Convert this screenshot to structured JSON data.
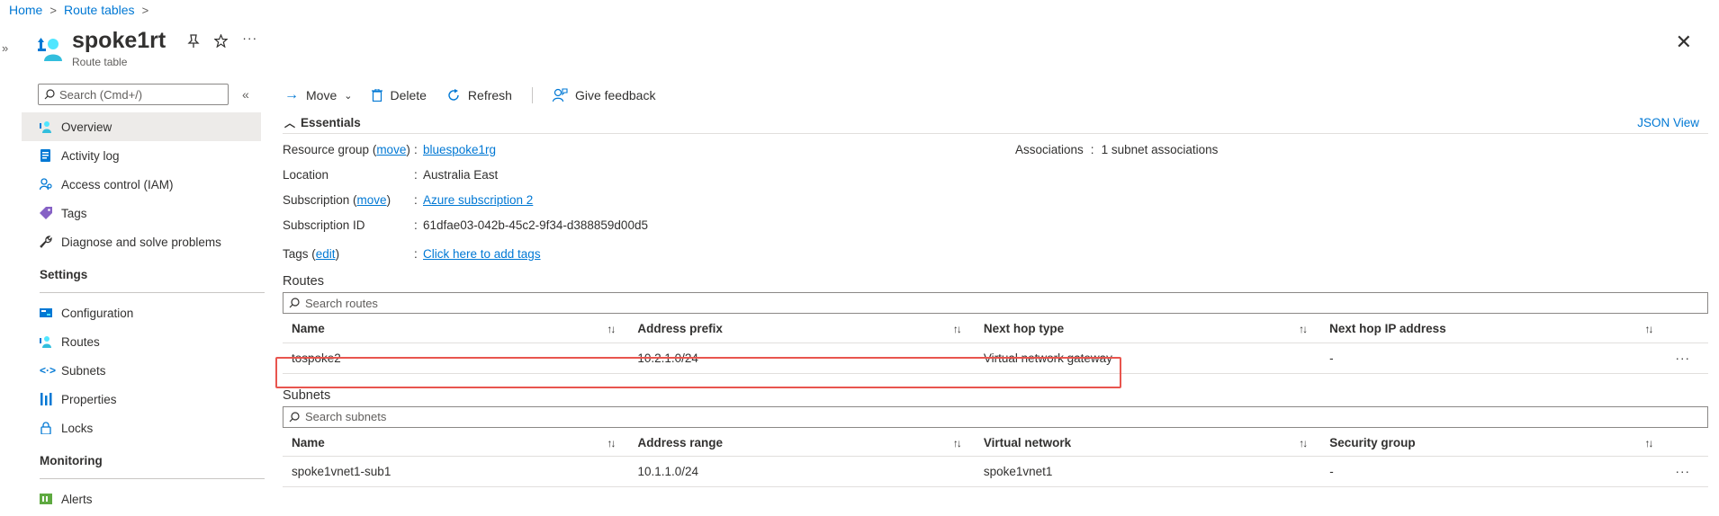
{
  "breadcrumb": [
    "Home",
    "Route tables"
  ],
  "resource": {
    "name": "spoke1rt",
    "type": "Route table"
  },
  "sidebar": {
    "search_placeholder": "Search (Cmd+/)",
    "items": [
      {
        "label": "Overview",
        "icon": "overview-icon",
        "active": true
      },
      {
        "label": "Activity log",
        "icon": "activity-log-icon"
      },
      {
        "label": "Access control (IAM)",
        "icon": "iam-icon"
      },
      {
        "label": "Tags",
        "icon": "tag-icon"
      },
      {
        "label": "Diagnose and solve problems",
        "icon": "wrench-icon"
      }
    ],
    "settings_header": "Settings",
    "settings_items": [
      {
        "label": "Configuration",
        "icon": "configuration-icon"
      },
      {
        "label": "Routes",
        "icon": "routes-icon"
      },
      {
        "label": "Subnets",
        "icon": "subnets-icon"
      },
      {
        "label": "Properties",
        "icon": "properties-icon"
      },
      {
        "label": "Locks",
        "icon": "lock-icon"
      }
    ],
    "monitoring_header": "Monitoring",
    "monitoring_items": [
      {
        "label": "Alerts",
        "icon": "alerts-icon"
      }
    ]
  },
  "toolbar": {
    "move": "Move",
    "delete": "Delete",
    "refresh": "Refresh",
    "feedback": "Give feedback"
  },
  "essentials": {
    "title": "Essentials",
    "json_view": "JSON View",
    "resource_group_label": "Resource group",
    "move_link": "move",
    "resource_group_value": "bluespoke1rg",
    "location_label": "Location",
    "location_value": "Australia East",
    "subscription_label": "Subscription",
    "subscription_value": "Azure subscription 2",
    "subscription_id_label": "Subscription ID",
    "subscription_id_value": "61dfae03-042b-45c2-9f34-d388859d00d5",
    "tags_label": "Tags",
    "edit_link": "edit",
    "tags_value": "Click here to add tags",
    "associations_label": "Associations",
    "associations_value": "1 subnet associations"
  },
  "routes": {
    "title": "Routes",
    "search_placeholder": "Search routes",
    "columns": [
      "Name",
      "Address prefix",
      "Next hop type",
      "Next hop IP address"
    ],
    "rows": [
      {
        "name": "tospoke2",
        "prefix": "10.2.1.0/24",
        "hop_type": "Virtual network gateway",
        "hop_ip": "-"
      }
    ]
  },
  "subnets": {
    "title": "Subnets",
    "search_placeholder": "Search subnets",
    "columns": [
      "Name",
      "Address range",
      "Virtual network",
      "Security group"
    ],
    "rows": [
      {
        "name": "spoke1vnet1-sub1",
        "range": "10.1.1.0/24",
        "vnet": "spoke1vnet1",
        "nsg": "-"
      }
    ]
  },
  "colors": {
    "accent": "#0078d4",
    "highlight": "#e8554e"
  }
}
